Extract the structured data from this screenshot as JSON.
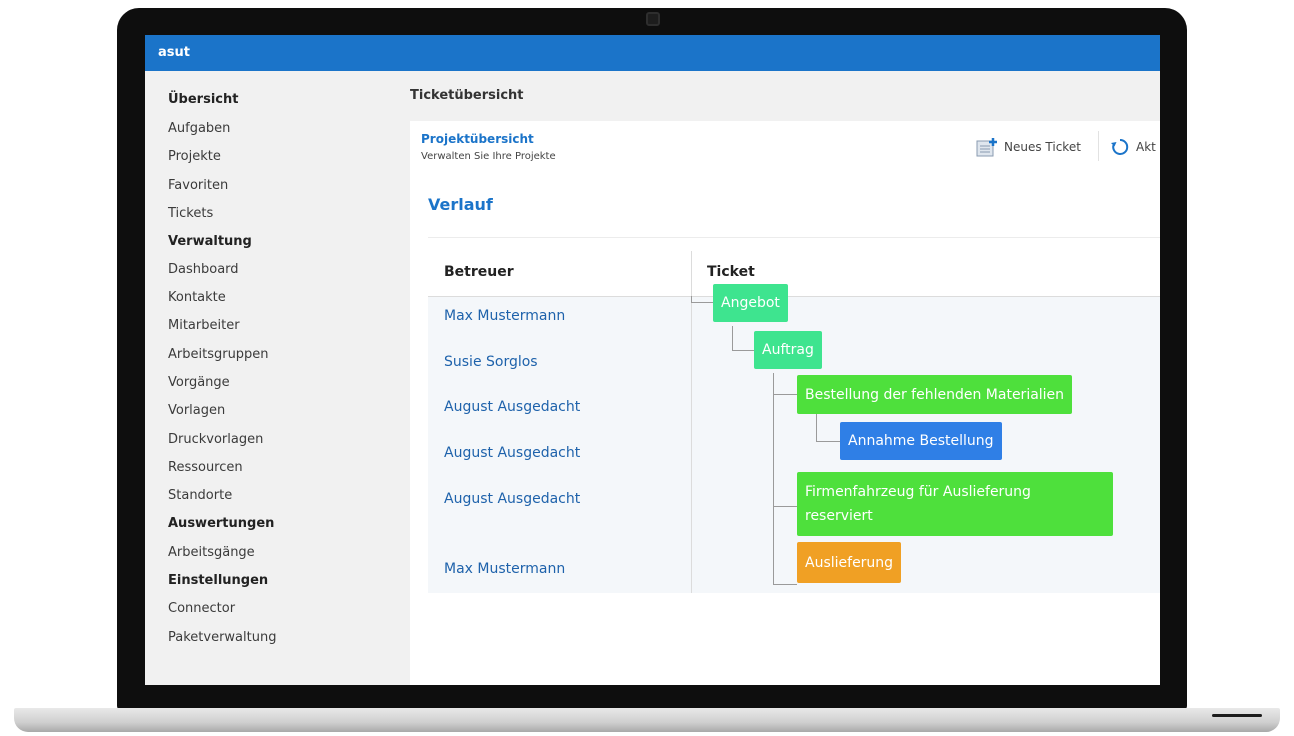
{
  "app": {
    "title": "asut"
  },
  "sidebar": {
    "items": [
      {
        "label": "Übersicht",
        "section": true
      },
      {
        "label": "Aufgaben",
        "section": false
      },
      {
        "label": "Projekte",
        "section": false
      },
      {
        "label": "Favoriten",
        "section": false
      },
      {
        "label": "Tickets",
        "section": false
      },
      {
        "label": "Verwaltung",
        "section": true
      },
      {
        "label": "Dashboard",
        "section": false
      },
      {
        "label": "Kontakte",
        "section": false
      },
      {
        "label": "Mitarbeiter",
        "section": false
      },
      {
        "label": "Arbeitsgruppen",
        "section": false
      },
      {
        "label": "Vorgänge",
        "section": false
      },
      {
        "label": "Vorlagen",
        "section": false
      },
      {
        "label": "Druckvorlagen",
        "section": false
      },
      {
        "label": "Ressourcen",
        "section": false
      },
      {
        "label": "Standorte",
        "section": false
      },
      {
        "label": "Auswertungen",
        "section": true
      },
      {
        "label": "Arbeitsgänge",
        "section": false
      },
      {
        "label": "Einstellungen",
        "section": true
      },
      {
        "label": "Connector",
        "section": false
      },
      {
        "label": "Paketverwaltung",
        "section": false
      }
    ]
  },
  "main": {
    "header": "Ticketübersicht",
    "panel": {
      "title": "Projektübersicht",
      "subtitle": "Verwalten Sie Ihre Projekte",
      "toolbar": {
        "new_ticket": "Neues Ticket",
        "refresh": "Akt"
      },
      "section_title": "Verlauf",
      "columns": {
        "assignee": "Betreuer",
        "ticket": "Ticket"
      },
      "rows": [
        {
          "assignee": "Max Mustermann",
          "ticket": "Angebot",
          "color": "#3ee48f"
        },
        {
          "assignee": "Susie Sorglos",
          "ticket": "Auftrag",
          "color": "#3ee48f"
        },
        {
          "assignee": "August Ausgedacht",
          "ticket": "Bestellung der fehlenden Materialien",
          "color": "#4ee03c"
        },
        {
          "assignee": "August Ausgedacht",
          "ticket": "Annahme Bestellung",
          "color": "#2f7fe6"
        },
        {
          "assignee": "August Ausgedacht",
          "ticket_line1": "Firmenfahrzeug für Auslieferung",
          "ticket_line2": "reserviert",
          "color": "#4ee03c"
        },
        {
          "assignee": "Max Mustermann",
          "ticket": "Auslieferung",
          "color": "#f0a024"
        }
      ]
    }
  },
  "icons": {
    "new_ticket": "new-ticket-icon",
    "refresh": "refresh-icon"
  }
}
